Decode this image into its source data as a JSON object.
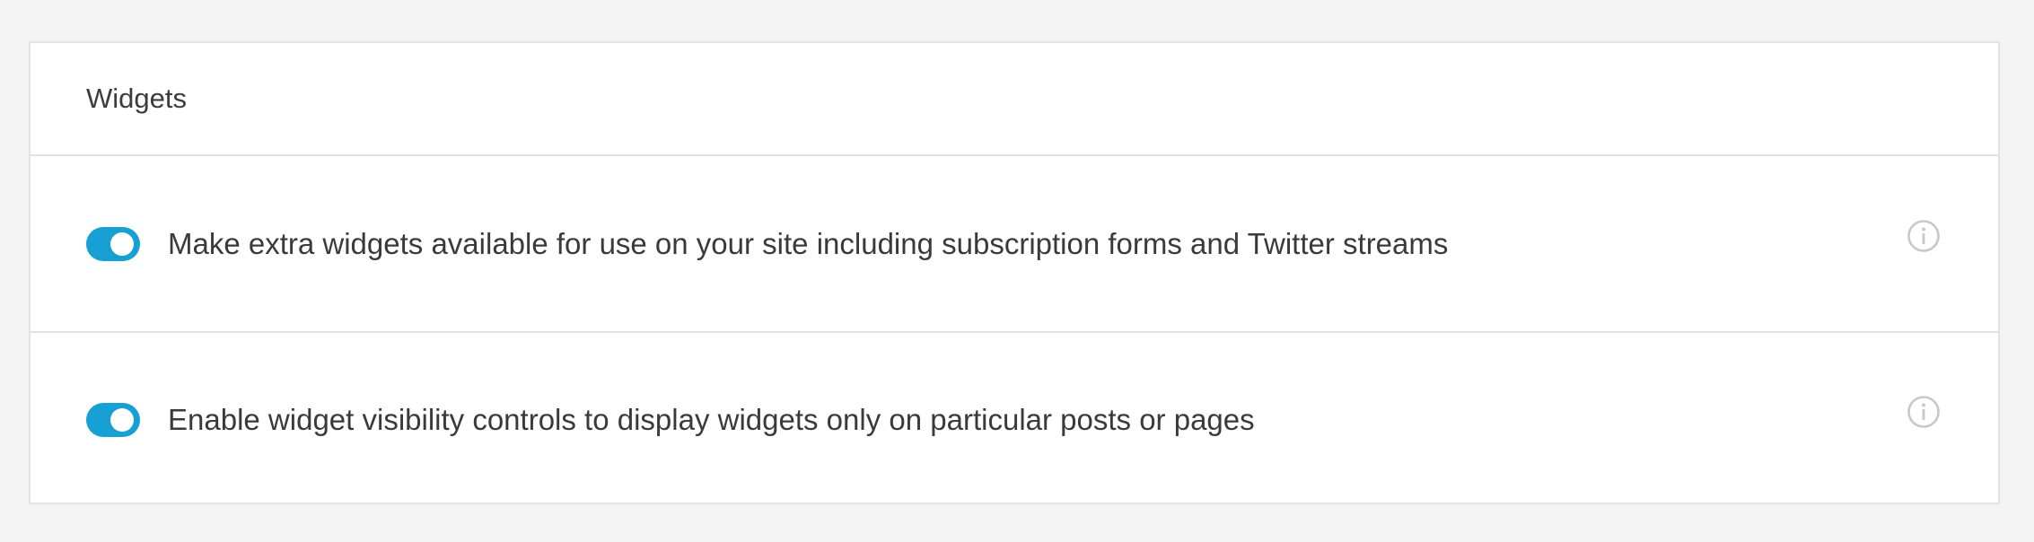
{
  "section": {
    "title": "Widgets"
  },
  "settings": [
    {
      "label": "Make extra widgets available for use on your site including subscription forms and Twitter streams",
      "enabled": true,
      "info_icon": "info-icon"
    },
    {
      "label": "Enable widget visibility controls to display widgets only on particular posts or pages",
      "enabled": true,
      "info_icon": "info-icon"
    }
  ],
  "colors": {
    "toggle_on": "#16a0d3",
    "background": "#f3f3f3",
    "panel": "#ffffff",
    "border": "#e2e2e2",
    "info_icon": "#c8c8c8"
  }
}
